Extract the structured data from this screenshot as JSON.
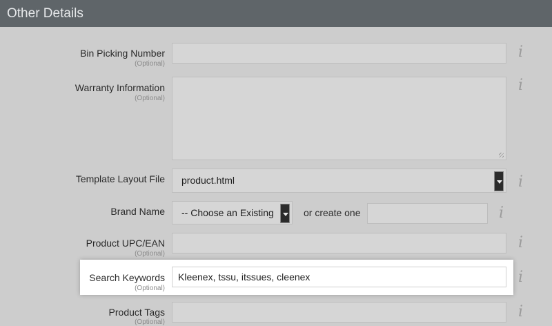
{
  "header": {
    "title": "Other Details"
  },
  "optional_text": "(Optional)",
  "fields": {
    "bin_picking": {
      "label": "Bin Picking Number",
      "value": ""
    },
    "warranty": {
      "label": "Warranty Information",
      "value": ""
    },
    "template_layout": {
      "label": "Template Layout File",
      "selected": "product.html"
    },
    "brand": {
      "label": "Brand Name",
      "selected": "-- Choose an Existing",
      "create_label": "or create one",
      "create_value": ""
    },
    "upc": {
      "label": "Product UPC/EAN",
      "value": ""
    },
    "search_keywords": {
      "label": "Search Keywords",
      "value": "Kleenex, tssu, itssues, cleenex"
    },
    "product_tags": {
      "label": "Product Tags",
      "value": ""
    }
  },
  "info_glyph": "i"
}
